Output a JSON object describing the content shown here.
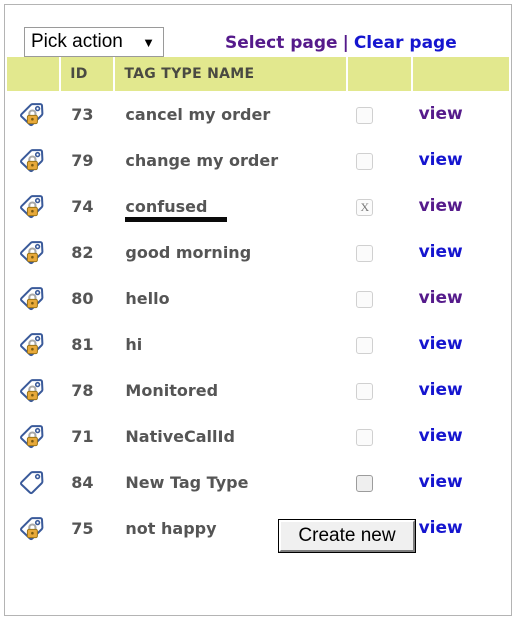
{
  "toolbar": {
    "action_select": {
      "label": "Pick action",
      "caret": "▼"
    },
    "select_page_label": "Select page",
    "separator": "|",
    "clear_page_label": "Clear page"
  },
  "table": {
    "columns": [
      "",
      "ID",
      "TAG TYPE NAME",
      "",
      ""
    ],
    "rows": [
      {
        "icon": "tag-lock-icon",
        "id": "73",
        "name": "cancel my order",
        "checked": false,
        "checkbox_mark": "",
        "checkbox_focused": false,
        "marker": false,
        "view_label": "view",
        "view_state": "visited"
      },
      {
        "icon": "tag-lock-icon",
        "id": "79",
        "name": "change my order",
        "checked": false,
        "checkbox_mark": "",
        "checkbox_focused": false,
        "marker": false,
        "view_label": "view",
        "view_state": "unvisited"
      },
      {
        "icon": "tag-lock-icon",
        "id": "74",
        "name": "confused",
        "checked": true,
        "checkbox_mark": "X",
        "checkbox_focused": false,
        "marker": true,
        "view_label": "view",
        "view_state": "visited"
      },
      {
        "icon": "tag-lock-icon",
        "id": "82",
        "name": "good morning",
        "checked": false,
        "checkbox_mark": "",
        "checkbox_focused": false,
        "marker": false,
        "view_label": "view",
        "view_state": "unvisited"
      },
      {
        "icon": "tag-lock-icon",
        "id": "80",
        "name": "hello",
        "checked": false,
        "checkbox_mark": "",
        "checkbox_focused": false,
        "marker": false,
        "view_label": "view",
        "view_state": "visited"
      },
      {
        "icon": "tag-lock-icon",
        "id": "81",
        "name": "hi",
        "checked": false,
        "checkbox_mark": "",
        "checkbox_focused": false,
        "marker": false,
        "view_label": "view",
        "view_state": "unvisited"
      },
      {
        "icon": "tag-lock-icon",
        "id": "78",
        "name": "Monitored",
        "checked": false,
        "checkbox_mark": "",
        "checkbox_focused": false,
        "marker": false,
        "view_label": "view",
        "view_state": "unvisited"
      },
      {
        "icon": "tag-lock-icon",
        "id": "71",
        "name": "NativeCallId",
        "checked": false,
        "checkbox_mark": "",
        "checkbox_focused": false,
        "marker": false,
        "view_label": "view",
        "view_state": "unvisited"
      },
      {
        "icon": "tag-icon",
        "id": "84",
        "name": "New Tag Type",
        "checked": false,
        "checkbox_mark": "",
        "checkbox_focused": true,
        "marker": false,
        "view_label": "view",
        "view_state": "unvisited"
      },
      {
        "icon": "tag-lock-icon",
        "id": "75",
        "name": "not happy",
        "checked": false,
        "checkbox_mark": "",
        "checkbox_focused": false,
        "marker": false,
        "view_label": "view",
        "view_state": "unvisited"
      }
    ]
  },
  "footer": {
    "create_new_label": "Create new"
  },
  "colors": {
    "header_bg": "#e2e88e",
    "text_gray": "#555555",
    "link_visited": "#551a8b",
    "link_unvisited": "#1515cf",
    "marker_bar": "#0a0a0a",
    "frame_border": "#b4b4b4",
    "tag_outline": "#3a5a9a",
    "lock_body": "#e8a93a"
  }
}
